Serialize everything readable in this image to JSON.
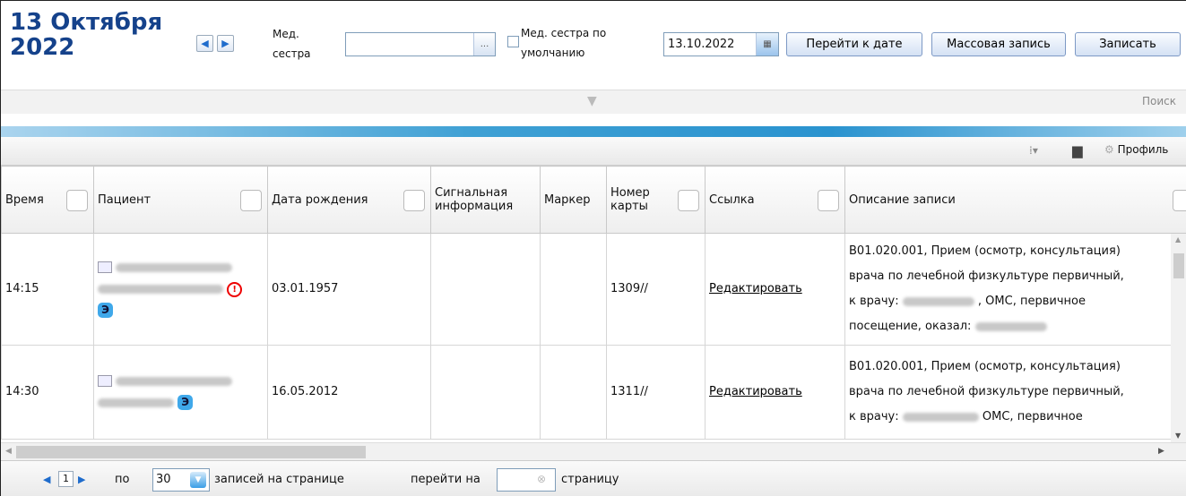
{
  "header": {
    "date_line1": "13 Октября",
    "date_line2": "2022",
    "nurse_label_line1": "Мед.",
    "nurse_label_line2": "сестра",
    "nurse_value": "",
    "default_nurse_line1": "Мед. сестра по",
    "default_nurse_line2": "умолчанию",
    "date_value": "13.10.2022",
    "goto_date_button": "Перейти к дате",
    "mass_record_button": "Массовая запись",
    "record_button": "Записать"
  },
  "search_panel": {
    "label": "Поиск"
  },
  "toolbar": {
    "profile_label": "Профиль"
  },
  "table": {
    "columns": [
      "Время",
      "Пациент",
      "Дата рождения",
      "Сигнальная информация",
      "Маркер",
      "Номер карты",
      "Ссылка",
      "Описание записи"
    ],
    "rows": [
      {
        "time": "14:15",
        "birth_date": "03.01.1957",
        "signal_info": "",
        "marker": "",
        "card_number": "1309//",
        "link": "Редактировать",
        "desc_line1": "B01.020.001, Прием (осмотр, консультация)",
        "desc_line2": "врача по лечебной физкультуре первичный,",
        "desc_line3a": "к врачу:",
        "desc_line3b": ", ОМС, первичное",
        "desc_line4": "посещение, оказал:",
        "badge": "Э"
      },
      {
        "time": "14:30",
        "birth_date": "16.05.2012",
        "signal_info": "",
        "marker": "",
        "card_number": "1311//",
        "link": "Редактировать",
        "desc_line1": "B01.020.001, Прием (осмотр, консультация)",
        "desc_line2": "врача по лечебной физкультуре первичный,",
        "desc_line3a": "к врачу:",
        "desc_line3b": "ОМС, первичное",
        "badge": "Э"
      }
    ]
  },
  "pager": {
    "current_page": "1",
    "per_label": "по",
    "page_size": "30",
    "records_label": "записей на странице",
    "goto_label": "перейти на",
    "goto_value": "",
    "page_label": "страницу"
  },
  "colors": {
    "title": "#15428b",
    "accent": "#2a93cf"
  }
}
